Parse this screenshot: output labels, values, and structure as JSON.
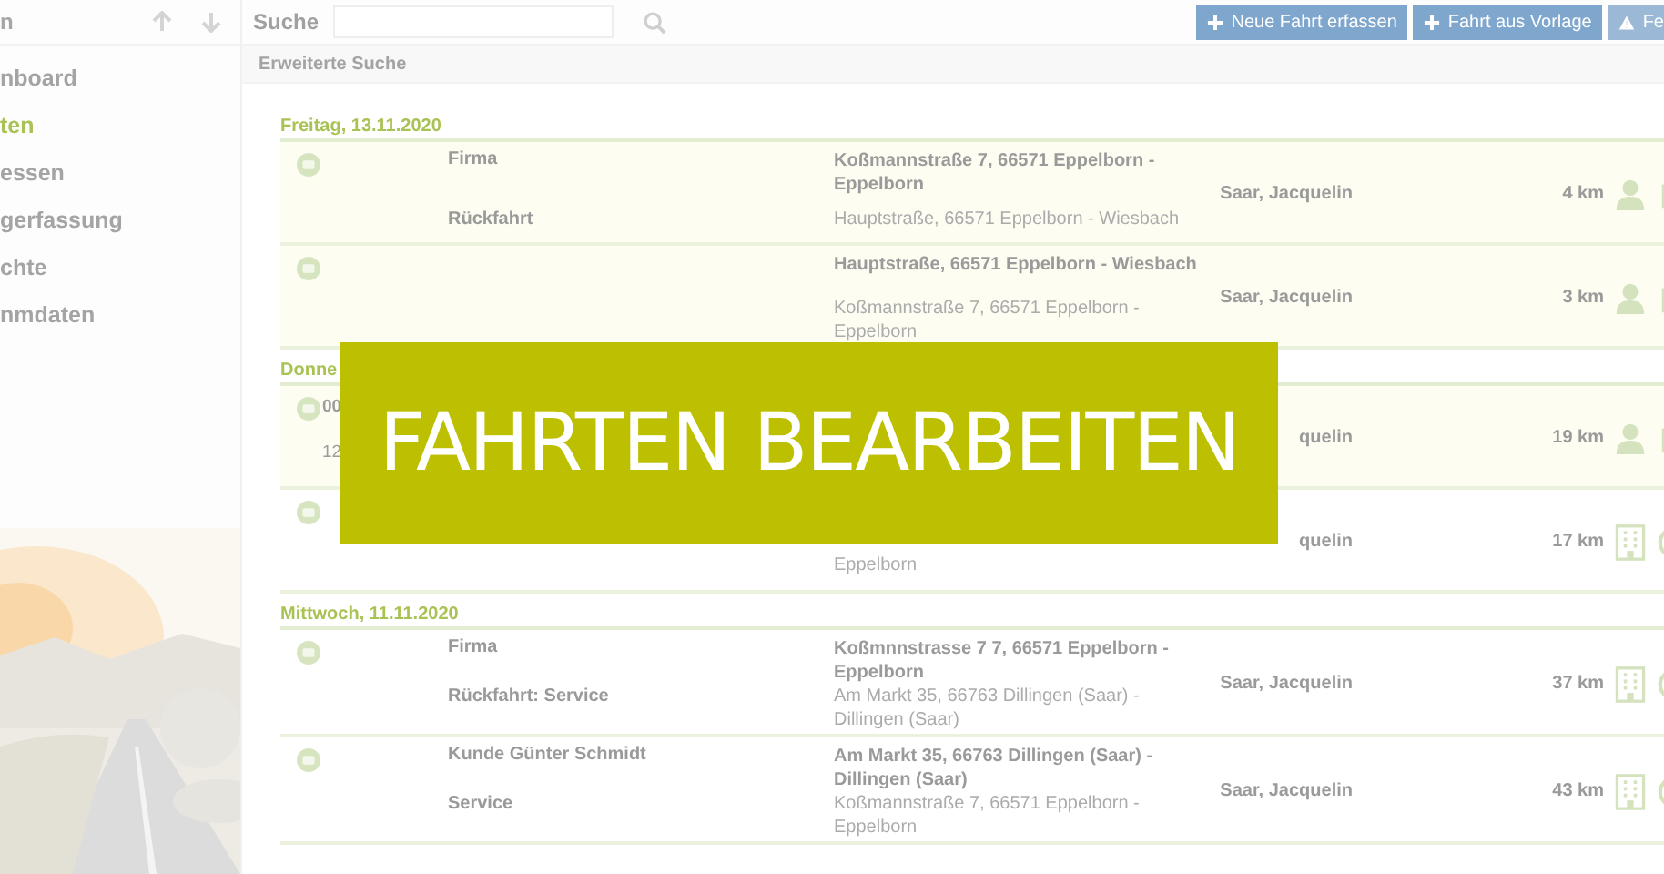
{
  "sidebar": {
    "title": "n",
    "items": [
      {
        "label": "nboard",
        "selected": false
      },
      {
        "label": "ten",
        "selected": true
      },
      {
        "label": "essen",
        "selected": false
      },
      {
        "label": "gerfassung",
        "selected": false
      },
      {
        "label": "chte",
        "selected": false
      },
      {
        "label": "nmdaten",
        "selected": false
      }
    ]
  },
  "toolbar": {
    "search_label": "Suche",
    "buttons": [
      {
        "label": "Neue Fahrt erfassen",
        "kind": "add"
      },
      {
        "label": "Fahrt aus Vorlage",
        "kind": "add"
      },
      {
        "label": "Fe",
        "kind": "warning"
      }
    ]
  },
  "advanced_search": "Erweiterte Suche",
  "groups": [
    {
      "date": "Freitag, 13.11.2020",
      "rows": [
        {
          "highlighted": true,
          "purpose": "Firma",
          "from": "Koßmannstraße 7, 66571 Eppelborn - Eppelborn",
          "return": "Rückfahrt",
          "to": "Hauptstraße, 66571 Eppelborn - Wiesbach",
          "driver": "Saar, Jacquelin",
          "distance": "4 km",
          "kind": "private"
        },
        {
          "highlighted": true,
          "from": "Hauptstraße, 66571 Eppelborn - Wiesbach",
          "to": "Koßmannstraße 7, 66571 Eppelborn - Eppelborn",
          "driver": "Saar, Jacquelin",
          "distance": "3 km",
          "kind": "private"
        }
      ]
    },
    {
      "date": "Donne",
      "rows": [
        {
          "highlighted": true,
          "time": "00",
          "return_time": "12",
          "driver": "quelin",
          "distance": "19 km",
          "kind": "private"
        },
        {
          "highlighted": false,
          "to": "Eppelborn",
          "driver": "quelin",
          "distance": "17 km",
          "kind": "business"
        }
      ]
    },
    {
      "date": "Mittwoch, 11.11.2020",
      "rows": [
        {
          "highlighted": false,
          "purpose": "Firma",
          "from": "Koßmnnstrasse 7 7, 66571 Eppelborn - Eppelborn",
          "return": "Rückfahrt: Service",
          "to": "Am Markt 35, 66763 Dillingen (Saar) - Dillingen (Saar)",
          "driver": "Saar, Jacquelin",
          "distance": "37 km",
          "kind": "business"
        },
        {
          "highlighted": false,
          "purpose": "Kunde Günter Schmidt",
          "from": "Am Markt 35, 66763 Dillingen (Saar) - Dillingen (Saar)",
          "return": "Service",
          "to": "Koßmannstraße 7, 66571 Eppelborn - Eppelborn",
          "driver": "Saar, Jacquelin",
          "distance": "43 km",
          "kind": "business"
        }
      ]
    }
  ],
  "banner": "FAHRTEN BEARBEITEN"
}
